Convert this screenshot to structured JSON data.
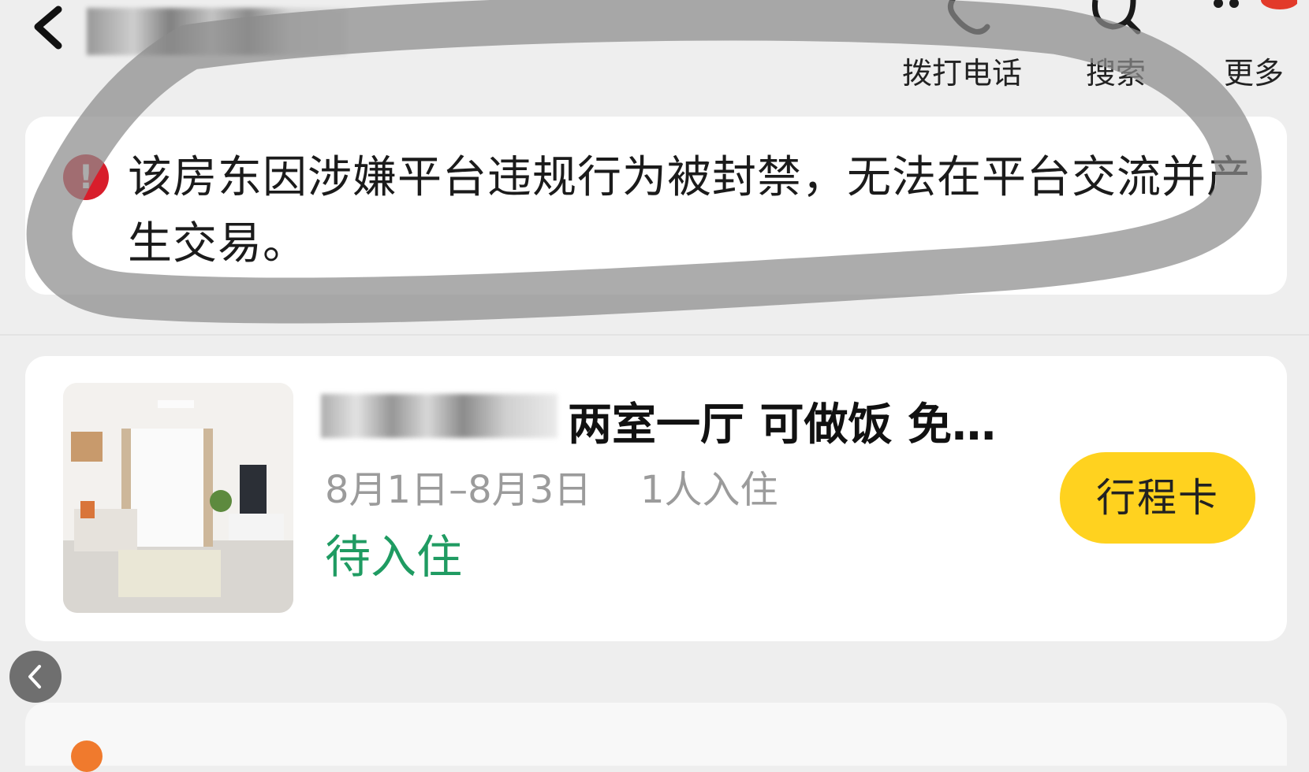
{
  "header": {
    "back_icon": "back-arrow-icon",
    "actions": [
      {
        "icon": "phone-icon",
        "label": "拨打电话"
      },
      {
        "icon": "search-icon",
        "label": "搜索"
      },
      {
        "icon": "more-icon",
        "label": "更多"
      }
    ]
  },
  "notice": {
    "icon": "alert-icon",
    "icon_glyph": "!",
    "message": "该房东因涉嫌平台违规行为被封禁，无法在平台交流并产生交易。"
  },
  "listing": {
    "title": "两室一厅 可做饭 免…",
    "dates": "8月1日–8月3日",
    "guests": "1人入住",
    "status": "待入住",
    "itinerary_button": "行程卡"
  },
  "colors": {
    "alert_red": "#d81e2b",
    "status_green": "#1f9b62",
    "button_yellow": "#ffd21f",
    "page_bg": "#eeeeee"
  }
}
